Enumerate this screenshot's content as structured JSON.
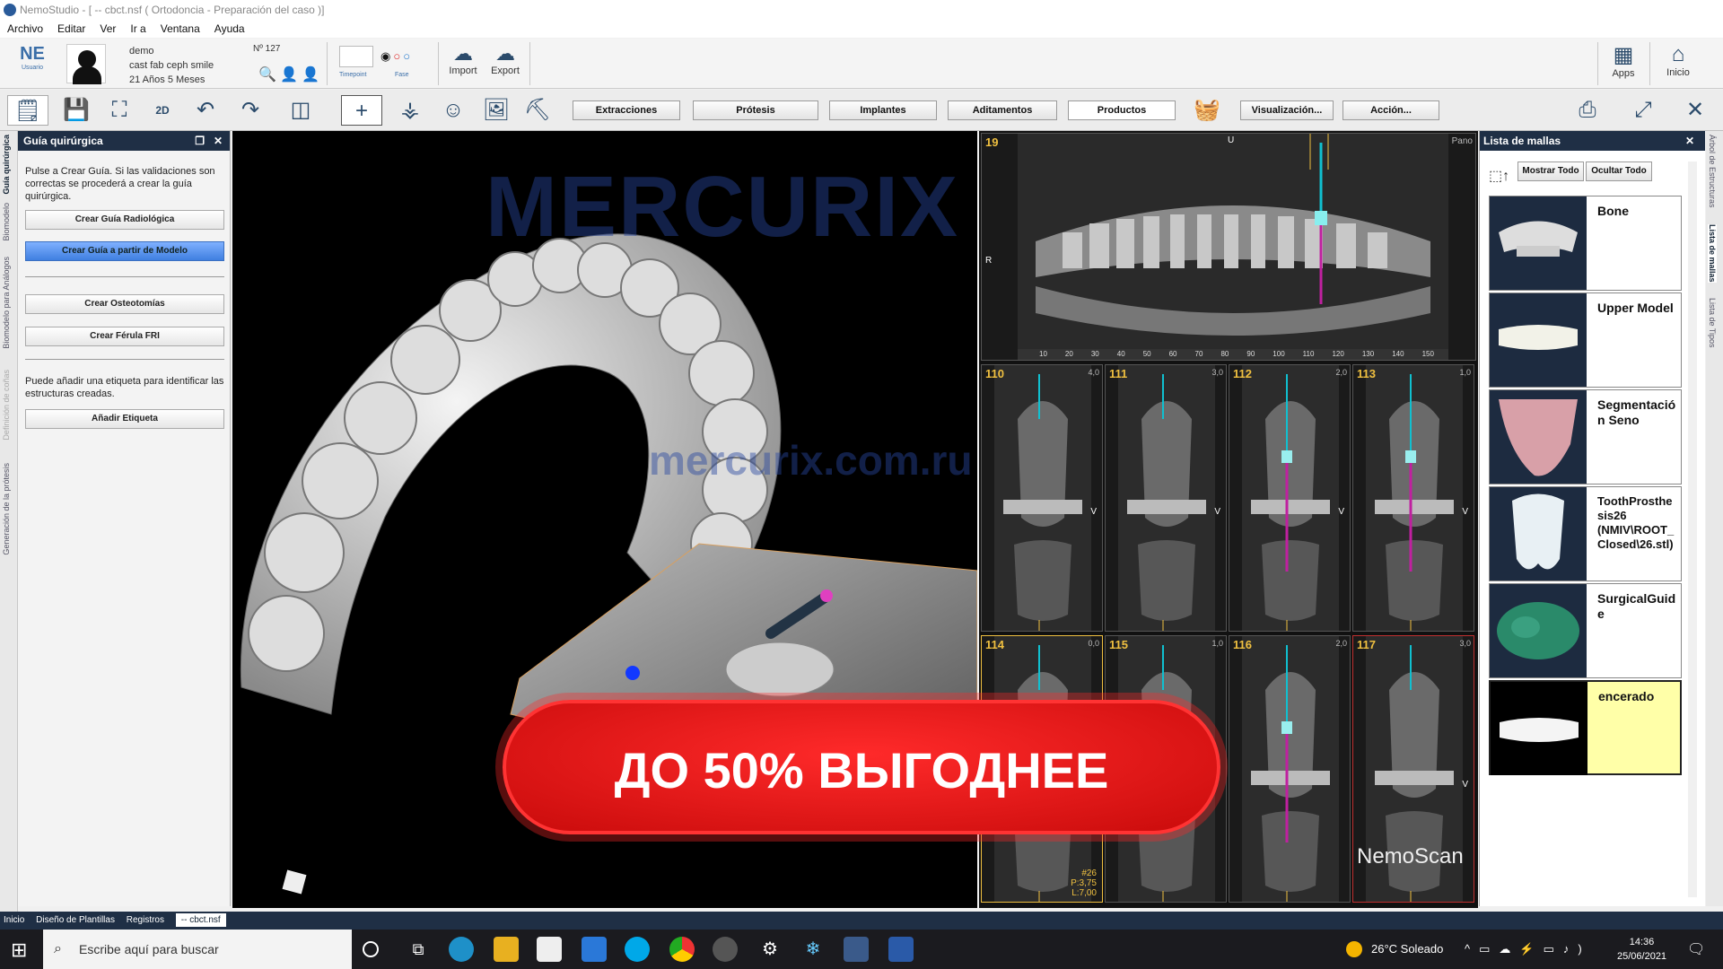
{
  "window": {
    "title": "NemoStudio - [ -- cbct.nsf ( Ortodoncia - Preparación del caso )]"
  },
  "menu": [
    "Archivo",
    "Editar",
    "Ver",
    "Ir a",
    "Ventana",
    "Ayuda"
  ],
  "ribbon": {
    "logo": "NE",
    "logo_sub": "Usuario",
    "patient_name": "demo",
    "patient_case": "cast fab ceph smile",
    "patient_age": "21 Años 5 Meses",
    "patient_no": "Nº 127",
    "timepoint": "Timepoint",
    "fase": "Fase",
    "import": "Import",
    "export": "Export",
    "apps": "Apps",
    "inicio": "Inicio"
  },
  "toolbar": {
    "twod": "2D",
    "buttons": [
      "Extracciones",
      "Prótesis",
      "Implantes",
      "Aditamentos",
      "Productos",
      "Visualización...",
      "Acción..."
    ]
  },
  "left_tabs": [
    "Guía quirúrgica",
    "Biomodelo",
    "Biomodelo para Análogos",
    "Definición de coñas",
    "Generación de la prótesis"
  ],
  "left_panel": {
    "title": "Guía quirúrgica",
    "intro": "Pulse a Crear Guía. Si las validaciones son correctas se procederá a crear la guía quirúrgica.",
    "btn_radiologica": "Crear Guía Radiológica",
    "btn_modelo": "Crear Guía a partir de Modelo",
    "btn_osteotomias": "Crear Osteotomías",
    "btn_ferula": "Crear Férula FRI",
    "label_text": "Puede añadir una etiqueta para identificar las estructuras creadas.",
    "btn_etiqueta": "Añadir Etiqueta"
  },
  "viewport": {
    "watermark1": "MERCURIX",
    "watermark2": "mercurix.com.ru"
  },
  "ct": {
    "pano_num": "19",
    "pano_label": "Pano",
    "pano_u": "U",
    "pano_r": "R",
    "pano_ticks": [
      "10",
      "20",
      "30",
      "40",
      "50",
      "60",
      "70",
      "80",
      "90",
      "100",
      "110",
      "120",
      "130",
      "140",
      "150"
    ],
    "slices": [
      {
        "num": "110",
        "sub": "4,0"
      },
      {
        "num": "111",
        "sub": "3,0"
      },
      {
        "num": "112",
        "sub": "2,0"
      },
      {
        "num": "113",
        "sub": "1,0"
      },
      {
        "num": "114",
        "sub": "0,0"
      },
      {
        "num": "115",
        "sub": "1,0"
      },
      {
        "num": "116",
        "sub": "2,0"
      },
      {
        "num": "117",
        "sub": "3,0"
      }
    ],
    "v_label": "V",
    "implant_info": [
      "#26",
      "P:3,75",
      "L:7,00"
    ],
    "brand": "NemoScan"
  },
  "right_panel": {
    "title": "Lista de mallas",
    "show_all": "Mostrar Todo",
    "hide_all": "Ocultar Todo",
    "meshes": [
      "Bone",
      "Upper Model",
      "Segmentación Seno",
      "ToothProsthesis26 (NMIV\\ROOT_Closed\\26.stl)",
      "SurgicalGuide",
      "encerado"
    ]
  },
  "right_tabs": [
    "Árbol de Estructuras",
    "Lista de mallas",
    "Lista de Tipos"
  ],
  "status_tabs": [
    "Inicio",
    "Diseño de Plantillas",
    "Registros",
    "-- cbct.nsf"
  ],
  "promo": "ДО 50% ВЫГОДНЕЕ",
  "taskbar": {
    "search": "Escribe aquí para buscar",
    "weather": "26°C Soleado",
    "time": "14:36",
    "date": "25/06/2021"
  }
}
